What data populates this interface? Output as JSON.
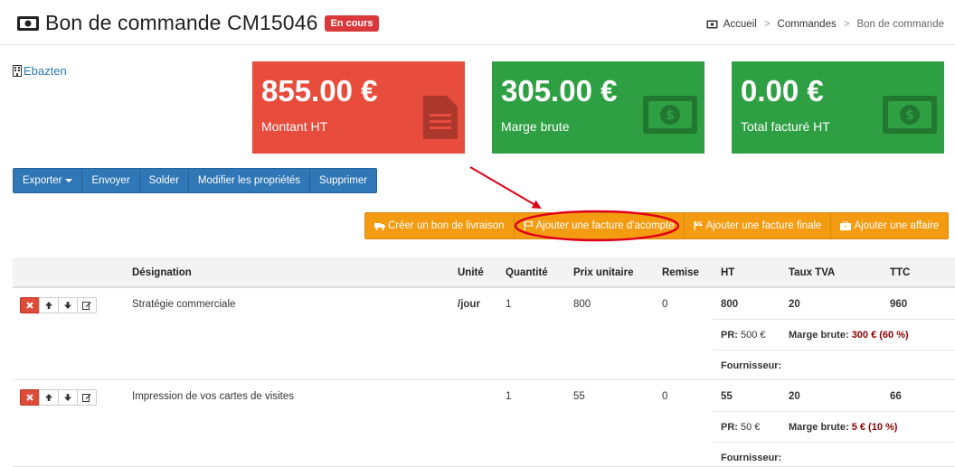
{
  "header": {
    "title": "Bon de commande CM15046",
    "status": "En cours",
    "breadcrumb": [
      "Accueil",
      "Commandes",
      "Bon de commande"
    ]
  },
  "company": "Ebazten",
  "kpis": [
    {
      "value": "855.00 €",
      "label": "Montant HT",
      "color": "#e74c3c",
      "icon": "document-icon"
    },
    {
      "value": "305.00 €",
      "label": "Marge brute",
      "color": "#2ea043",
      "icon": "money-icon"
    },
    {
      "value": "0.00 €",
      "label": "Total facturé HT",
      "color": "#2ea043",
      "icon": "money-icon"
    }
  ],
  "toolbar": {
    "export": "Exporter",
    "send": "Envoyer",
    "settle": "Solder",
    "edit_props": "Modifier les propriétés",
    "delete": "Supprimer"
  },
  "actions": {
    "delivery": "Créer un bon de livraison",
    "deposit_invoice": "Ajouter une facture d'acompte",
    "final_invoice": "Ajouter une facture finale",
    "add_deal": "Ajouter une affaire"
  },
  "table": {
    "headers": [
      "Désignation",
      "Unité",
      "Quantité",
      "Prix unitaire",
      "Remise",
      "HT",
      "Taux TVA",
      "TTC"
    ],
    "rows": [
      {
        "designation": "Stratégie commerciale",
        "unit": "/jour",
        "qty": "1",
        "price": "800",
        "discount": "0",
        "ht": "800",
        "tva": "20",
        "ttc": "960",
        "pr_label": "PR:",
        "pr_value": "500 €",
        "margin_label": "Marge brute:",
        "margin_value": "300 € (60 %)",
        "supplier_label": "Fournisseur:"
      },
      {
        "designation": "Impression de vos cartes de visites",
        "unit": "",
        "qty": "1",
        "price": "55",
        "discount": "0",
        "ht": "55",
        "tva": "20",
        "ttc": "66",
        "pr_label": "PR:",
        "pr_value": "50 €",
        "margin_label": "Marge brute:",
        "margin_value": "5 € (10 %)",
        "supplier_label": "Fournisseur:"
      }
    ]
  },
  "colors": {
    "accent_blue": "#2f77b6",
    "accent_orange": "#f39c12",
    "annotation_red": "#e0001a"
  }
}
